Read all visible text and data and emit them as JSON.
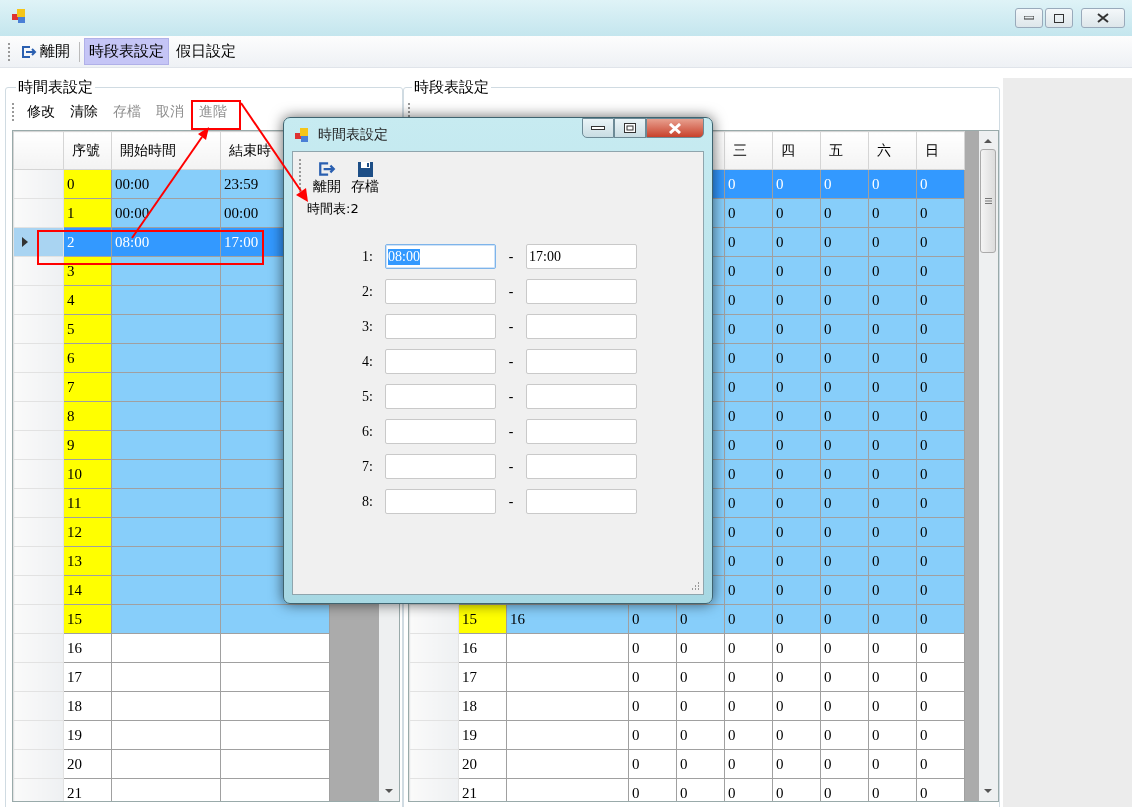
{
  "menu": [
    {
      "kind": "exit",
      "label": "離開",
      "selected": false
    },
    {
      "kind": "plain",
      "label": "時段表設定",
      "selected": true
    },
    {
      "kind": "plain",
      "label": "假日設定",
      "selected": false
    }
  ],
  "time_tables": {
    "title": "時間表設定",
    "toolbar": [
      {
        "label": "修改",
        "disabled": false
      },
      {
        "label": "清除",
        "disabled": false
      },
      {
        "label": "存檔",
        "disabled": true
      },
      {
        "label": "取消",
        "disabled": true
      },
      {
        "label": "進階",
        "disabled": true
      }
    ],
    "columns": [
      "序號",
      "開始時間",
      "結束時"
    ],
    "rows": [
      {
        "seq": "0",
        "start": "00:00",
        "end": "23:59",
        "highlighted": true,
        "selected": false
      },
      {
        "seq": "1",
        "start": "00:00",
        "end": "00:00",
        "highlighted": true,
        "selected": false
      },
      {
        "seq": "2",
        "start": "08:00",
        "end": "17:00",
        "selected": true
      },
      {
        "seq": "3",
        "highlighted": true,
        "selected": false
      },
      {
        "seq": "4",
        "highlighted": true,
        "selected": false
      },
      {
        "seq": "5",
        "highlighted": true,
        "selected": false
      },
      {
        "seq": "6",
        "highlighted": true,
        "selected": false
      },
      {
        "seq": "7",
        "highlighted": true,
        "selected": false
      },
      {
        "seq": "8",
        "highlighted": true,
        "selected": false
      },
      {
        "seq": "9",
        "highlighted": true,
        "selected": false
      },
      {
        "seq": "10",
        "highlighted": true,
        "selected": false
      },
      {
        "seq": "11",
        "highlighted": true,
        "selected": false
      },
      {
        "seq": "12",
        "highlighted": true,
        "selected": false
      },
      {
        "seq": "13",
        "highlighted": true,
        "selected": false
      },
      {
        "seq": "14",
        "highlighted": true,
        "selected": false
      },
      {
        "seq": "15",
        "highlighted": true,
        "selected": false
      },
      {
        "seq": "16",
        "highlighted": false,
        "selected": false
      },
      {
        "seq": "17",
        "highlighted": false,
        "selected": false
      },
      {
        "seq": "18",
        "highlighted": false,
        "selected": false
      },
      {
        "seq": "19",
        "highlighted": false,
        "selected": false
      },
      {
        "seq": "20",
        "highlighted": false,
        "selected": false
      },
      {
        "seq": "21",
        "highlighted": false,
        "selected": false
      }
    ]
  },
  "period_tables": {
    "title": "時段表設定",
    "columns": [
      "三",
      "四",
      "五",
      "六",
      "日"
    ],
    "rows": [
      {
        "days": [
          "0",
          "0",
          "0",
          "0",
          "0"
        ],
        "selected": true
      },
      {
        "days": [
          "0",
          "0",
          "0",
          "0",
          "0"
        ],
        "highlighted": true,
        "selected": false
      },
      {
        "days": [
          "0",
          "0",
          "0",
          "0",
          "0"
        ],
        "highlighted": true,
        "selected": false
      },
      {
        "days": [
          "0",
          "0",
          "0",
          "0",
          "0"
        ],
        "highlighted": true,
        "selected": false
      },
      {
        "days": [
          "0",
          "0",
          "0",
          "0",
          "0"
        ],
        "highlighted": true,
        "selected": false
      },
      {
        "days": [
          "0",
          "0",
          "0",
          "0",
          "0"
        ],
        "highlighted": true,
        "selected": false
      },
      {
        "days": [
          "0",
          "0",
          "0",
          "0",
          "0"
        ],
        "highlighted": true,
        "selected": false
      },
      {
        "days": [
          "0",
          "0",
          "0",
          "0",
          "0"
        ],
        "highlighted": true,
        "selected": false
      },
      {
        "days": [
          "0",
          "0",
          "0",
          "0",
          "0"
        ],
        "highlighted": true,
        "selected": false
      },
      {
        "days": [
          "0",
          "0",
          "0",
          "0",
          "0"
        ],
        "highlighted": true,
        "selected": false
      },
      {
        "days": [
          "0",
          "0",
          "0",
          "0",
          "0"
        ],
        "highlighted": true,
        "selected": false
      },
      {
        "days": [
          "0",
          "0",
          "0",
          "0",
          "0"
        ],
        "highlighted": true,
        "selected": false
      },
      {
        "days": [
          "0",
          "0",
          "0",
          "0",
          "0"
        ],
        "highlighted": true,
        "selected": false
      },
      {
        "days": [
          "0",
          "0",
          "0",
          "0",
          "0"
        ],
        "highlighted": true,
        "selected": false
      },
      {
        "days": [
          "0",
          "0",
          "0",
          "0",
          "0"
        ],
        "highlighted": true,
        "selected": false
      },
      {
        "seq": "15",
        "name": "16",
        "days": [
          "0",
          "0",
          "0",
          "0",
          "0",
          "0",
          "0"
        ],
        "highlighted": true,
        "selected": false
      },
      {
        "seq": "16",
        "days": [
          "0",
          "0",
          "0",
          "0",
          "0",
          "0",
          "0"
        ],
        "highlighted": false,
        "selected": false
      },
      {
        "seq": "17",
        "days": [
          "0",
          "0",
          "0",
          "0",
          "0",
          "0",
          "0"
        ],
        "highlighted": false,
        "selected": false
      },
      {
        "seq": "18",
        "days": [
          "0",
          "0",
          "0",
          "0",
          "0",
          "0",
          "0"
        ],
        "highlighted": false,
        "selected": false
      },
      {
        "seq": "19",
        "days": [
          "0",
          "0",
          "0",
          "0",
          "0",
          "0",
          "0"
        ],
        "highlighted": false,
        "selected": false
      },
      {
        "seq": "20",
        "days": [
          "0",
          "0",
          "0",
          "0",
          "0",
          "0",
          "0"
        ],
        "highlighted": false,
        "selected": false
      },
      {
        "seq": "21",
        "days": [
          "0",
          "0",
          "0",
          "0",
          "0",
          "0",
          "0"
        ],
        "highlighted": false,
        "selected": false
      }
    ]
  },
  "dialog": {
    "title": "時間表設定",
    "toolbar": [
      {
        "kind": "exit",
        "label": "離開"
      },
      {
        "kind": "save",
        "label": "存檔"
      }
    ],
    "caption": "時間表:2",
    "slots": [
      {
        "label": "1:",
        "start": "08:00",
        "dash": "-",
        "end": "17:00",
        "start_selected": true
      },
      {
        "label": "2:",
        "dash": "-",
        "start_selected": false
      },
      {
        "label": "3:",
        "dash": "-",
        "start_selected": false
      },
      {
        "label": "4:",
        "dash": "-",
        "start_selected": false
      },
      {
        "label": "5:",
        "dash": "-",
        "start_selected": false
      },
      {
        "label": "6:",
        "dash": "-",
        "start_selected": false
      },
      {
        "label": "7:",
        "dash": "-",
        "start_selected": false
      },
      {
        "label": "8:",
        "dash": "-",
        "start_selected": false
      }
    ]
  }
}
